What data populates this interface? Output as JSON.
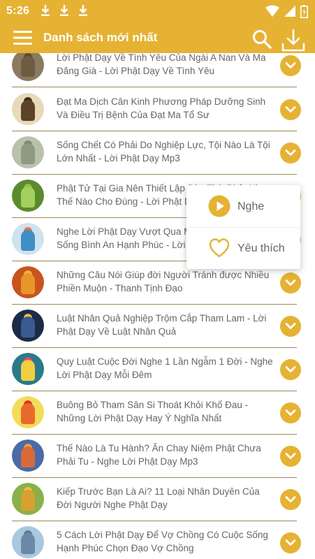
{
  "status_bar": {
    "time": "5:26",
    "icons": [
      "download-notification-icon",
      "download-notification-icon",
      "download-notification-icon",
      "wifi-icon",
      "signal-icon",
      "battery-icon"
    ]
  },
  "app_bar": {
    "title": "Danh sách mới nhất",
    "icons": [
      "menu-icon",
      "search-icon",
      "download-icon"
    ]
  },
  "colors": {
    "accent": "#E5B233",
    "text": "#666666",
    "divider": "#9a8a5a"
  },
  "items": [
    {
      "title": "Lời Phật Dạy Về Tình Yêu Của Ngài A Nan Và Ma Đăng Già - Lời Phật Dạy Về Tình Yêu"
    },
    {
      "title": "Đạt Ma Dịch Cân Kinh Phương Pháp Dưỡng Sinh Và Điều Trị Bệnh Của Đạt Ma Tổ Sư"
    },
    {
      "title": "Sống Chết Có Phải Do Nghiệp Lực, Tội Nào Là Tội Lớn Nhất - Lời Phật Dạy Mp3"
    },
    {
      "title": "Phật Tử Tại Gia Nên Thiết Lập Bàn Thờ Phật Như Thế Nào Cho Đúng - Lời Phật Dạy"
    },
    {
      "title": "Nghe Lời Phật Dạy Vượt Qua Mọi Khó Khăn Để Sống Bình An Hạnh Phúc - Lời Phật Dạy"
    },
    {
      "title": "Những Câu Nói Giúp đời Người Tránh được Nhiều Phiền Muộn - Thanh Tịnh Đạo"
    },
    {
      "title": "Luật Nhân Quả Nghiệp Trộm Cắp Tham Lam - Lời Phật Dạy Về Luật Nhân Quả"
    },
    {
      "title": "Quy Luật Cuộc Đời Nghe 1 Lần Ngẫm 1 Đời - Nghe Lời Phật Dạy Mỗi Đêm"
    },
    {
      "title": "Buông Bỏ Tham Sân Si Thoát Khỏi Khổ Đau - Những Lời Phật Dạy Hay Ý Nghĩa Nhất"
    },
    {
      "title": "Thế Nào Là Tu Hành? Ăn Chay Niệm Phật Chưa Phải Tu - Nghe Lời Phật Dạy Mp3"
    },
    {
      "title": "Kiếp Trước Bạn Là Ai? 11 Loại Nhân Duyên Của Đời Người Nghe Phật Dạy"
    },
    {
      "title": "5 Cách Lời Phật Dạy Để Vợ Chồng Có Cuộc Sống Hạnh Phúc Chọn Đạo Vợ Chồng"
    }
  ],
  "popup_menu": {
    "items": [
      {
        "label": "Nghe",
        "icon": "play-icon"
      },
      {
        "label": "Yêu thích",
        "icon": "heart-icon"
      }
    ]
  }
}
